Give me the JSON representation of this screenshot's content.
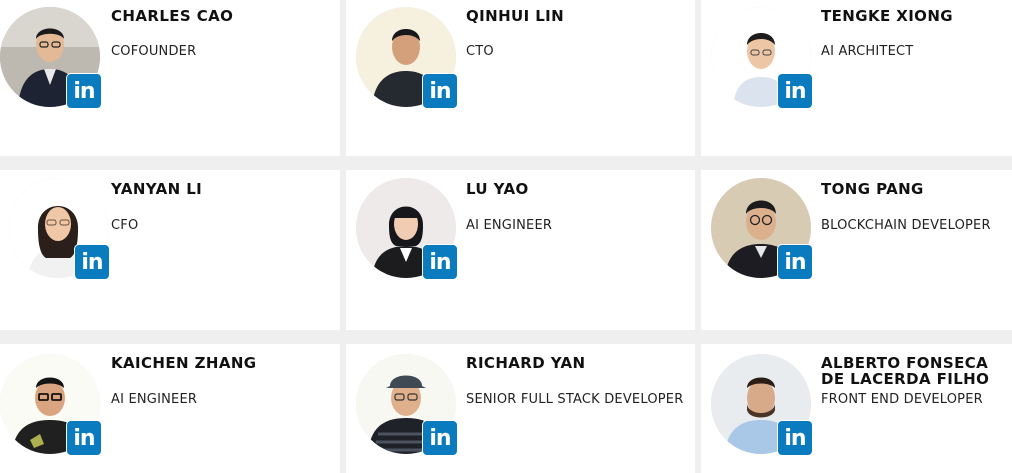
{
  "team": {
    "linkedin_label": "in",
    "members": [
      {
        "name": "CHARLES CAO",
        "role": "COFOUNDER"
      },
      {
        "name": "QINHUI LIN",
        "role": "CTO"
      },
      {
        "name": "TENGKE XIONG",
        "role": "AI ARCHITECT"
      },
      {
        "name": "YANYAN LI",
        "role": "CFO"
      },
      {
        "name": "LU YAO",
        "role": "AI ENGINEER"
      },
      {
        "name": "TONG PANG",
        "role": "BLOCKCHAIN DEVELOPER"
      },
      {
        "name": "KAICHEN ZHANG",
        "role": "AI ENGINEER"
      },
      {
        "name": "RICHARD YAN",
        "role": "SENIOR FULL STACK DEVELOPER"
      },
      {
        "name": "ALBERTO FONSECA DE LACERDA FILHO",
        "role": "FRONT END DEVELOPER"
      }
    ]
  },
  "colors": {
    "background": "#efefef",
    "card": "#ffffff",
    "linkedin": "#0b7bc0"
  }
}
